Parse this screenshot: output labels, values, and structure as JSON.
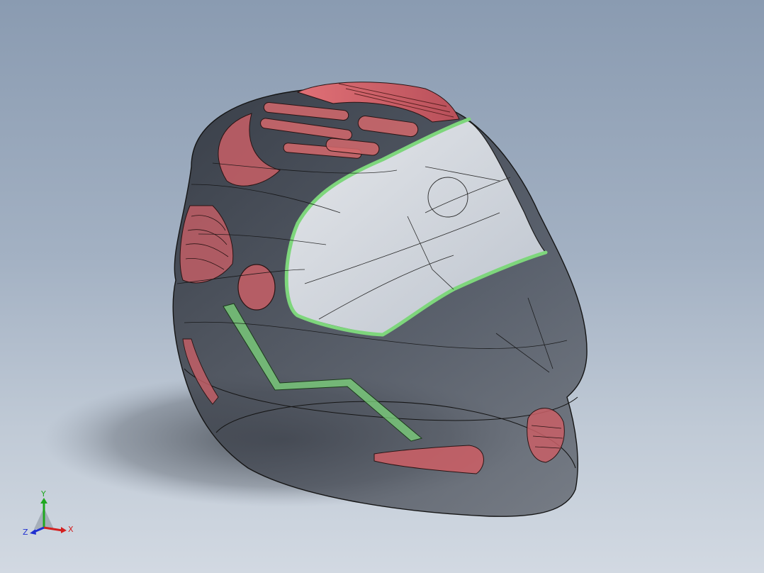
{
  "viewport": {
    "background_top": "#8a9bb1",
    "background_bottom": "#d2d9e2"
  },
  "model": {
    "shell_color": "#3c4048",
    "visor_color": "#e6eaf0",
    "red_feature_color": "#d4686c",
    "green_feature_color": "#7ed67c",
    "edge_color": "#1c1c1c"
  },
  "triad": {
    "y_label": "Y",
    "x_label": "X",
    "z_label": "Z",
    "y_color": "#1fa81f",
    "x_color": "#d42020",
    "z_color": "#2030d0"
  }
}
